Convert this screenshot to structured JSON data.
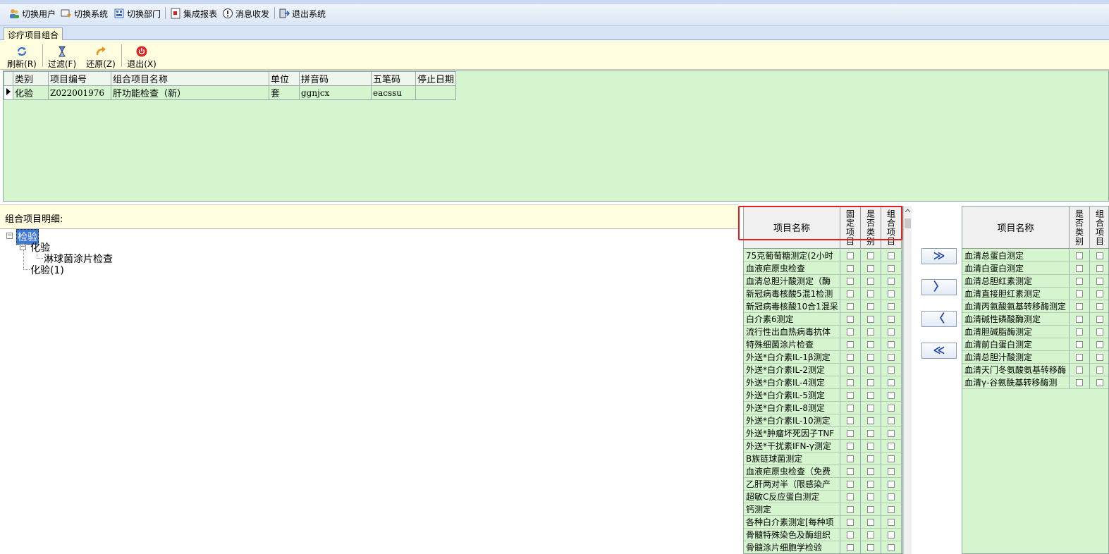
{
  "menubar": {
    "items": [
      {
        "label": "切换用户",
        "icon": "users-icon"
      },
      {
        "label": "切换系统",
        "icon": "switch-system-icon"
      },
      {
        "label": "切换部门",
        "icon": "department-icon"
      },
      {
        "label": "集成报表",
        "icon": "report-icon"
      },
      {
        "label": "消息收发",
        "icon": "message-icon"
      },
      {
        "label": "退出系统",
        "icon": "exit-icon"
      }
    ]
  },
  "tab": {
    "label": "诊疗项目组合"
  },
  "toolbar": {
    "refresh_label": "刷新(R)",
    "filter_label": "过滤(F)",
    "restore_label": "还原(Z)",
    "exit_label": "退出(X)"
  },
  "main_grid": {
    "columns": [
      "类别",
      "项目编号",
      "组合项目名称",
      "单位",
      "拼音码",
      "五笔码",
      "停止日期"
    ],
    "rows": [
      {
        "category": "化验",
        "code": "Z022001976",
        "name": "肝功能检查（新）",
        "unit": "套",
        "pinyin": "ggnjcx",
        "wubi": "eacssu",
        "stop_date": ""
      }
    ]
  },
  "detail": {
    "label": "组合项目明细:"
  },
  "tree": {
    "root": "检验",
    "child1": "化验",
    "grandchild": "淋球菌涂片检查",
    "child2": "化验(1)"
  },
  "left_list": {
    "headers": {
      "name": "项目名称",
      "fixed": "固定项目",
      "is_category": "是否类别",
      "combo": "组合项目"
    },
    "items": [
      "75克葡萄糖测定(2小时",
      "血液疟原虫检查",
      "血清总胆汁酸测定（酶",
      "新冠病毒核酸5混1检测",
      "新冠病毒核酸10合1混采",
      "白介素6测定",
      "流行性出血热病毒抗体",
      "特殊细菌涂片检查",
      "外送*白介素IL-1β测定",
      "外送*白介素IL-2测定",
      "外送*白介素IL-4测定",
      "外送*白介素IL-5测定",
      "外送*白介素IL-8测定",
      "外送*白介素IL-10测定",
      "外送*肿瘤坏死因子TNF",
      "外送*干扰素IFN-γ测定",
      "B族链球菌测定",
      "血液疟原虫检查（免费",
      "乙肝两对半（限感染产",
      "超敏C反应蛋白测定",
      "钙测定",
      "各种白介素测定[每种项",
      "骨髓特殊染色及酶组织",
      "骨髓涂片细胞学检验"
    ]
  },
  "transfer_buttons": {
    "add_all": "≫",
    "add_one": "〉",
    "remove_one": "〈",
    "remove_all": "≪"
  },
  "right_list": {
    "headers": {
      "name": "项目名称",
      "is_category": "是否类别",
      "combo": "组合项目"
    },
    "items": [
      "血清总蛋白测定",
      "血清白蛋白测定",
      "血清总胆红素测定",
      "血清直接胆红素测定",
      "血清丙氨酸氨基转移酶测定",
      "血清碱性磷酸酶测定",
      "血清胆碱脂酶测定",
      "血清前白蛋白测定",
      "血清总胆汁酸测定",
      "血清天门冬氨酸氨基转移酶",
      "血清γ-谷氨酰基转移酶测"
    ]
  },
  "colors": {
    "grid_bg": "#d5f5cf",
    "toolbar_bg": "#fffde0",
    "highlight": "#e02020",
    "tree_selected": "#3c78d8"
  }
}
